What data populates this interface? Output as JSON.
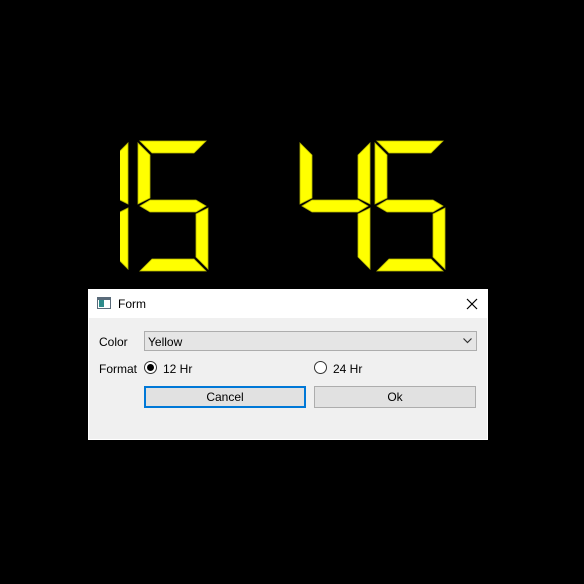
{
  "clock": {
    "hours": "15",
    "minutes": "45",
    "digit_color": "#ffff00",
    "background_color": "#000000"
  },
  "dialog": {
    "title": "Form",
    "close_icon": "close-icon",
    "color_label": "Color",
    "color_value": "Yellow",
    "format_label": "Format",
    "format_options": [
      {
        "label": "12 Hr",
        "selected": true
      },
      {
        "label": "24 Hr",
        "selected": false
      }
    ],
    "cancel_label": "Cancel",
    "ok_label": "Ok",
    "accent_color": "#0078d7"
  }
}
